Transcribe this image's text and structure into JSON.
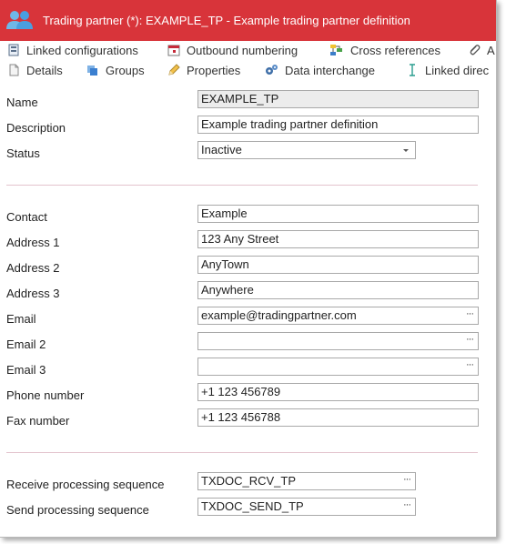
{
  "window": {
    "title": "Trading partner (*): EXAMPLE_TP - Example trading partner definition",
    "title_icon": "users-icon",
    "title_bar_color": "#d8343a"
  },
  "toolbar": {
    "row1": [
      {
        "label": "Linked configurations",
        "icon": "linked-configurations-icon"
      },
      {
        "label": "Outbound numbering",
        "icon": "calendar-icon"
      },
      {
        "label": "Cross references",
        "icon": "cross-references-icon"
      },
      {
        "label": "A",
        "icon": "paperclip-icon"
      }
    ],
    "row2": [
      {
        "label": "Details",
        "icon": "document-icon"
      },
      {
        "label": "Groups",
        "icon": "groups-icon"
      },
      {
        "label": "Properties",
        "icon": "pencil-icon"
      },
      {
        "label": "Data interchange",
        "icon": "gears-icon"
      },
      {
        "label": "Linked direc",
        "icon": "text-cursor-icon"
      }
    ]
  },
  "form": {
    "name": {
      "label": "Name",
      "value": "EXAMPLE_TP"
    },
    "description": {
      "label": "Description",
      "value": "Example trading partner definition"
    },
    "status": {
      "label": "Status",
      "value": "Inactive"
    },
    "contact": {
      "label": "Contact",
      "value": "Example"
    },
    "address1": {
      "label": "Address 1",
      "value": "123 Any Street"
    },
    "address2": {
      "label": "Address 2",
      "value": "AnyTown"
    },
    "address3": {
      "label": "Address 3",
      "value": "Anywhere"
    },
    "email": {
      "label": "Email",
      "value": "example@tradingpartner.com"
    },
    "email2": {
      "label": "Email 2",
      "value": ""
    },
    "email3": {
      "label": "Email 3",
      "value": ""
    },
    "phone": {
      "label": "Phone number",
      "value": "+1 123 456789"
    },
    "fax": {
      "label": "Fax number",
      "value": "+1 123 456788"
    },
    "receive_seq": {
      "label": "Receive processing sequence",
      "value": "TXDOC_RCV_TP"
    },
    "send_seq": {
      "label": "Send processing sequence",
      "value": "TXDOC_SEND_TP"
    },
    "ellipsis": "···"
  }
}
